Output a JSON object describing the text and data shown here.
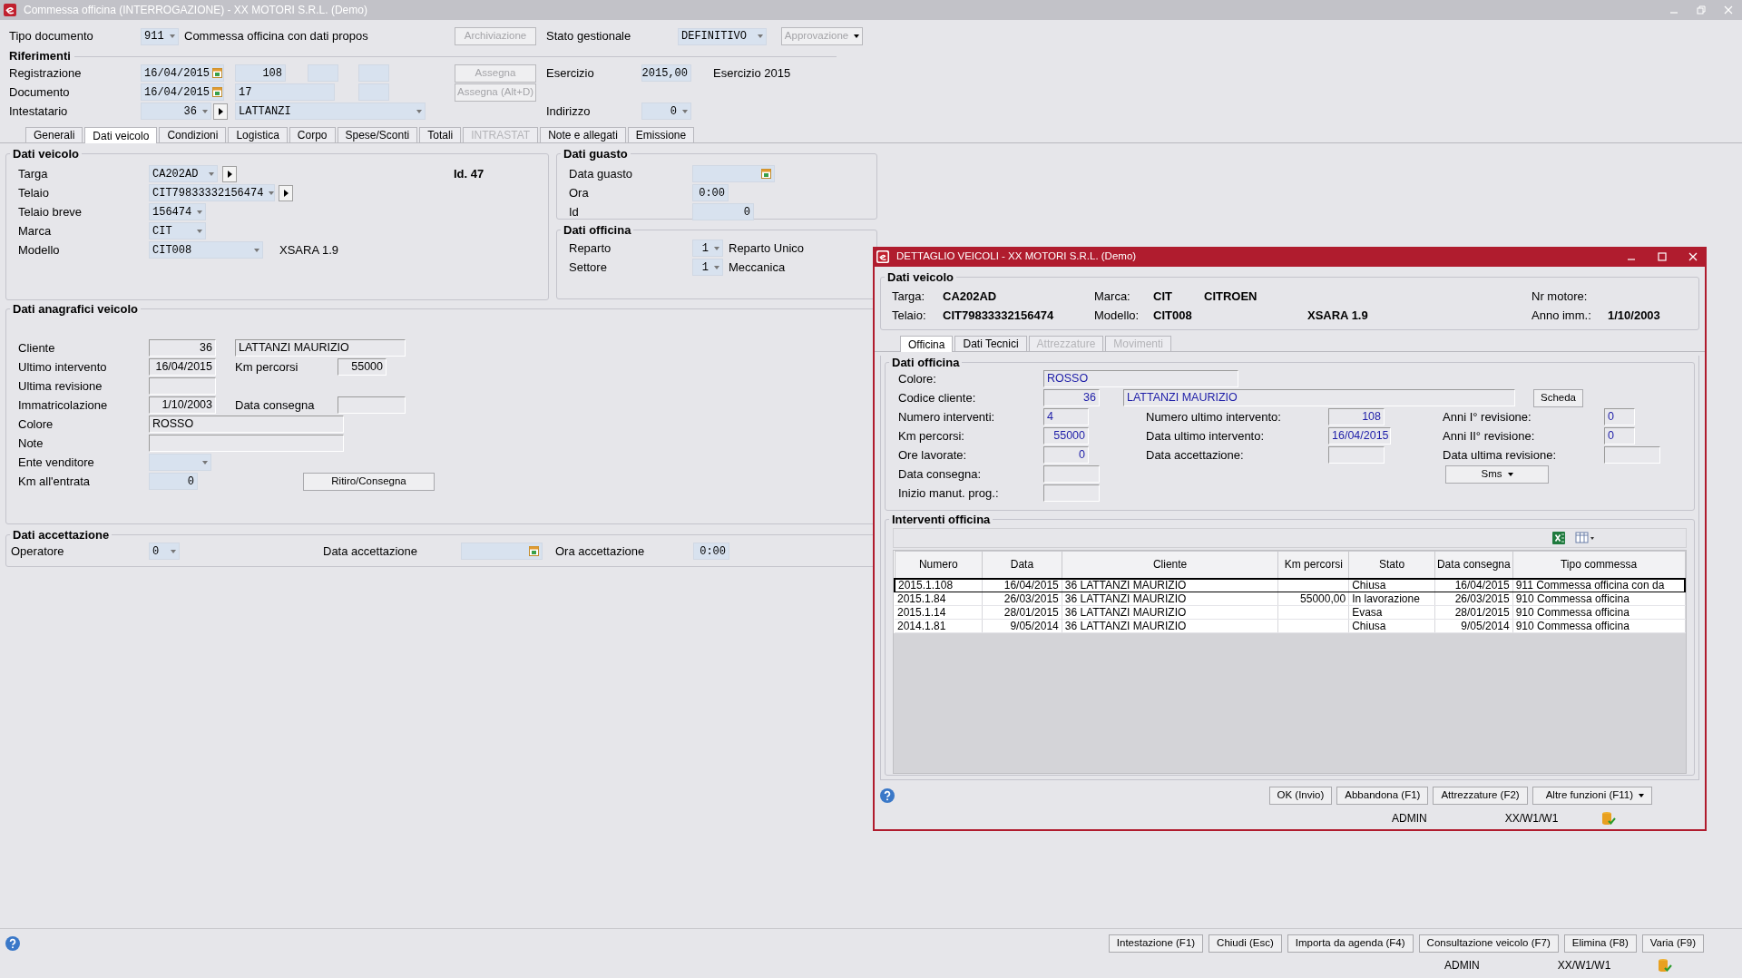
{
  "window": {
    "title": "Commessa officina (INTERROGAZIONE)  - XX  MOTORI S.R.L.  (Demo)"
  },
  "header": {
    "tipo_documento": {
      "label": "Tipo documento",
      "code": "911",
      "description": "Commessa officina con dati propos"
    },
    "archiviazione": {
      "label": "Archiviazione",
      "disabled": true
    },
    "stato_gestionale": {
      "label": "Stato gestionale",
      "value": "DEFINITIVO"
    },
    "approvazione": {
      "label": "Approvazione",
      "disabled": true
    }
  },
  "riferimenti": {
    "title": "Riferimenti",
    "registrazione": {
      "label": "Registrazione",
      "date": "16/04/2015",
      "number": "108"
    },
    "assegna": {
      "label": "Assegna",
      "disabled": true
    },
    "esercizio": {
      "label": "Esercizio",
      "value": "2015,00",
      "description": "Esercizio 2015"
    },
    "documento": {
      "label": "Documento",
      "date": "16/04/2015",
      "number": "17"
    },
    "assegna_alt": {
      "label": "Assegna (Alt+D)",
      "disabled": true
    },
    "intestatario": {
      "label": "Intestatario",
      "code": "36",
      "name": "LATTANZI"
    },
    "indirizzo": {
      "label": "Indirizzo",
      "value": "0"
    }
  },
  "tabs": [
    {
      "label": "Generali",
      "selected": false,
      "disabled": false
    },
    {
      "label": "Dati veicolo",
      "selected": true,
      "disabled": false
    },
    {
      "label": "Condizioni",
      "selected": false,
      "disabled": false
    },
    {
      "label": "Logistica",
      "selected": false,
      "disabled": false
    },
    {
      "label": "Corpo",
      "selected": false,
      "disabled": false
    },
    {
      "label": "Spese/Sconti",
      "selected": false,
      "disabled": false
    },
    {
      "label": "Totali",
      "selected": false,
      "disabled": false
    },
    {
      "label": "INTRASTAT",
      "selected": false,
      "disabled": true
    },
    {
      "label": "Note e allegati",
      "selected": false,
      "disabled": false
    },
    {
      "label": "Emissione",
      "selected": false,
      "disabled": false
    }
  ],
  "dati_veicolo": {
    "title": "Dati veicolo",
    "targa": {
      "label": "Targa",
      "value": "CA202AD"
    },
    "id": "Id. 47",
    "telaio": {
      "label": "Telaio",
      "value": "CIT79833332156474"
    },
    "telaio_breve": {
      "label": "Telaio breve",
      "value": "156474"
    },
    "marca": {
      "label": "Marca",
      "value": "CIT"
    },
    "modello": {
      "label": "Modello",
      "value": "CIT008",
      "description": "XSARA 1.9"
    }
  },
  "dati_guasto": {
    "title": "Dati guasto",
    "data_guasto": {
      "label": "Data guasto"
    },
    "ora": {
      "label": "Ora",
      "value": "0:00"
    },
    "id": {
      "label": "Id",
      "value": "0"
    }
  },
  "dati_officina": {
    "title": "Dati officina",
    "reparto": {
      "label": "Reparto",
      "code": "1",
      "description": "Reparto Unico"
    },
    "settore": {
      "label": "Settore",
      "code": "1",
      "description": "Meccanica"
    }
  },
  "dati_anagrafici": {
    "title": "Dati anagrafici veicolo",
    "cliente": {
      "label": "Cliente",
      "code": "36",
      "name": "LATTANZI MAURIZIO"
    },
    "ultimo_intervento": {
      "label": "Ultimo intervento",
      "value": "16/04/2015"
    },
    "km_percorsi": {
      "label": "Km percorsi",
      "value": "55000"
    },
    "ultima_revisione": {
      "label": "Ultima revisione"
    },
    "immatricolazione": {
      "label": "Immatricolazione",
      "value": "1/10/2003"
    },
    "data_consegna": {
      "label": "Data consegna"
    },
    "colore": {
      "label": "Colore",
      "value": "ROSSO"
    },
    "note": {
      "label": "Note"
    },
    "ente_venditore": {
      "label": "Ente venditore"
    },
    "km_entrata": {
      "label": "Km all'entrata",
      "value": "0"
    },
    "ritiro_button": "Ritiro/Consegna"
  },
  "dati_accettazione": {
    "title": "Dati accettazione",
    "operatore": {
      "label": "Operatore",
      "value": "0"
    },
    "data_accettazione": {
      "label": "Data accettazione"
    },
    "ora_accettazione": {
      "label": "Ora accettazione",
      "value": "0:00"
    }
  },
  "footer_buttons": [
    "Intestazione (F1)",
    "Chiudi (Esc)",
    "Importa da agenda (F4)",
    "Consultazione veicolo (F7)",
    "Elimina (F8)",
    "Varia (F9)"
  ],
  "status_bar": {
    "user": "ADMIN",
    "workstation": "XX/W1/W1"
  },
  "dialog": {
    "title": "DETTAGLIO VEICOLI - XX  MOTORI S.R.L.  (Demo)",
    "vehicle": {
      "title": "Dati veicolo",
      "targa_label": "Targa:",
      "targa": "CA202AD",
      "marca_label": "Marca:",
      "marca_code": "CIT",
      "marca_name": "CITROEN",
      "motore_label": "Nr motore:",
      "telaio_label": "Telaio:",
      "telaio": "CIT79833332156474",
      "modello_label": "Modello:",
      "modello_code": "CIT008",
      "modello_name": "XSARA 1.9",
      "anno_label": "Anno imm.:",
      "anno": "1/10/2003"
    },
    "tabs": [
      {
        "label": "Officina",
        "selected": true,
        "disabled": false
      },
      {
        "label": "Dati Tecnici",
        "selected": false,
        "disabled": false
      },
      {
        "label": "Attrezzature",
        "selected": false,
        "disabled": true
      },
      {
        "label": "Movimenti",
        "selected": false,
        "disabled": true
      }
    ],
    "officina": {
      "title": "Dati officina",
      "colore": {
        "label": "Colore:",
        "value": "ROSSO"
      },
      "codice_cliente": {
        "label": "Codice cliente:",
        "code": "36",
        "name": "LATTANZI MAURIZIO"
      },
      "scheda_button": "Scheda",
      "numero_interventi": {
        "label": "Numero interventi:",
        "value": "4"
      },
      "numero_ultimo": {
        "label": "Numero ultimo intervento:",
        "value": "108"
      },
      "anni_1": {
        "label": "Anni I° revisione:",
        "value": "0"
      },
      "km": {
        "label": "Km percorsi:",
        "value": "55000"
      },
      "data_ultimo": {
        "label": "Data ultimo intervento:",
        "value": "16/04/2015"
      },
      "anni_2": {
        "label": "Anni II° revisione:",
        "value": "0"
      },
      "ore": {
        "label": "Ore lavorate:",
        "value": "0"
      },
      "data_accettazione": {
        "label": "Data accettazione:"
      },
      "data_ultima_revisione": {
        "label": "Data ultima revisione:"
      },
      "data_consegna": {
        "label": "Data consegna:"
      },
      "sms_button": "Sms",
      "inizio": {
        "label": "Inizio manut. prog.:"
      }
    },
    "interventi": {
      "title": "Interventi officina",
      "columns": [
        "Numero",
        "Data",
        "Cliente",
        "Km percorsi",
        "Stato",
        "Data consegna",
        "Tipo commessa"
      ],
      "rows": [
        {
          "selected": true,
          "cells": [
            "2015.1.108",
            "16/04/2015",
            "36 LATTANZI MAURIZIO",
            "",
            "Chiusa",
            "16/04/2015",
            "911 Commessa officina con da"
          ]
        },
        {
          "selected": false,
          "cells": [
            "2015.1.84",
            "26/03/2015",
            "36 LATTANZI MAURIZIO",
            "55000,00",
            "In lavorazione",
            "26/03/2015",
            "910 Commessa officina"
          ]
        },
        {
          "selected": false,
          "cells": [
            "2015.1.14",
            "28/01/2015",
            "36 LATTANZI MAURIZIO",
            "",
            "Evasa",
            "28/01/2015",
            "910 Commessa officina"
          ]
        },
        {
          "selected": false,
          "cells": [
            "2014.1.81",
            "9/05/2014",
            "36 LATTANZI MAURIZIO",
            "",
            "Chiusa",
            "9/05/2014",
            "910 Commessa officina"
          ]
        }
      ]
    },
    "buttons": [
      {
        "label": "OK (Invio)",
        "kind": "plain"
      },
      {
        "label": "Abbandona (F1)",
        "kind": "plain"
      },
      {
        "label": "Attrezzature (F2)",
        "kind": "plain"
      },
      {
        "label": "Altre funzioni (F11)",
        "kind": "menu"
      }
    ],
    "status_bar": {
      "user": "ADMIN",
      "workstation": "XX/W1/W1"
    }
  }
}
